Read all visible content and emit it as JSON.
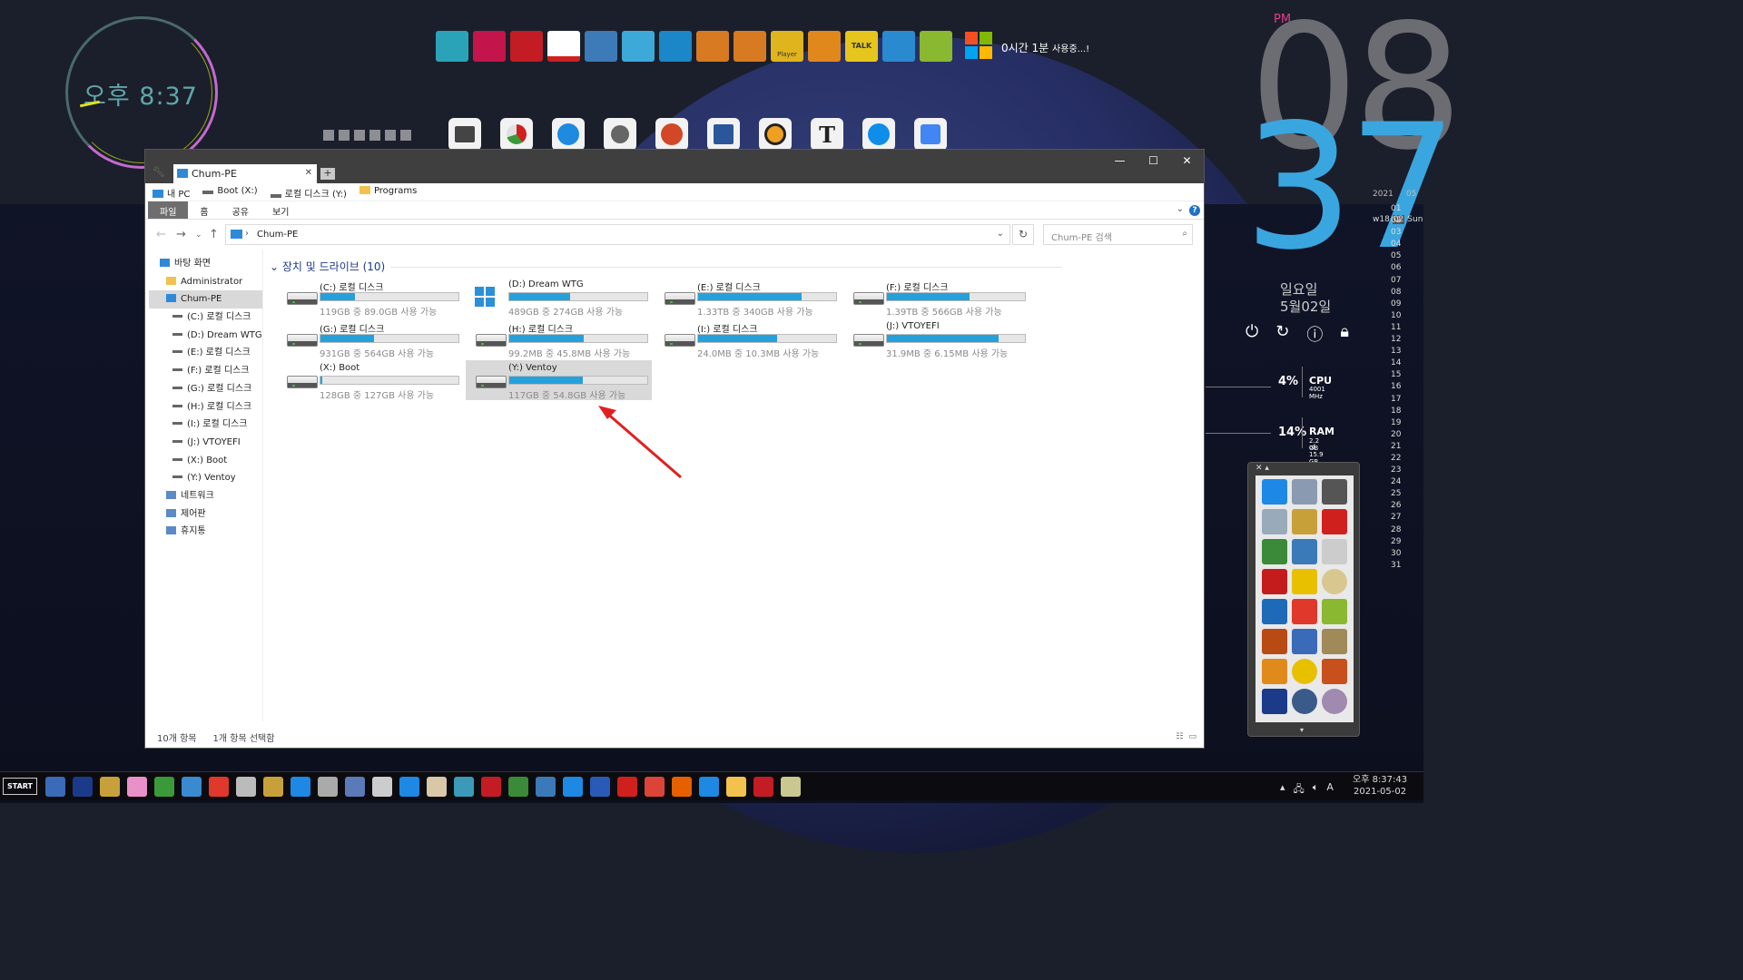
{
  "desktop": {
    "analog_clock_text": "오후 8:37",
    "usage_text": "0시간 1분",
    "usage_suffix": "사용중...!",
    "big_clock": {
      "ampm": "PM",
      "hour": "08",
      "minute": "37",
      "weekday": "일요일",
      "date": "5월02일"
    },
    "calendar": {
      "year": "2021",
      "month": "05",
      "week": "w18",
      "today": "02",
      "today_day": "Sun",
      "days": [
        "01",
        "02",
        "03",
        "04",
        "05",
        "06",
        "07",
        "08",
        "09",
        "10",
        "11",
        "12",
        "13",
        "14",
        "15",
        "16",
        "17",
        "18",
        "19",
        "20",
        "21",
        "22",
        "23",
        "24",
        "25",
        "26",
        "27",
        "28",
        "29",
        "30",
        "31"
      ]
    },
    "cpu": {
      "percent": "4%",
      "label": "CPU",
      "sub": "4001 MHz"
    },
    "ram": {
      "percent": "14%",
      "label": "RAM",
      "sub1": "2.2 GB",
      "sub2": "of 15.9 GB"
    },
    "dock_player_label": "Player",
    "dock_talk_label": "TALK",
    "dock_t_label": "T"
  },
  "window": {
    "tab_title": "Chum-PE",
    "new_tab": "+",
    "minimize": "—",
    "maximize": "☐",
    "close": "✕",
    "bookmarks": [
      "내 PC",
      "Boot (X:)",
      "로컬 디스크 (Y:)",
      "Programs"
    ],
    "ribbon_tabs": [
      "파일",
      "홈",
      "공유",
      "보기"
    ],
    "help": "?",
    "address": "Chum-PE",
    "search_placeholder": "Chum-PE 검색",
    "nav": [
      {
        "label": "바탕 화면",
        "indent": 0
      },
      {
        "label": "Administrator",
        "indent": 1
      },
      {
        "label": "Chum-PE",
        "indent": 1,
        "selected": true
      },
      {
        "label": "(C:) 로컬 디스크",
        "indent": 2
      },
      {
        "label": "(D:) Dream WTG",
        "indent": 2
      },
      {
        "label": "(E:) 로컬 디스크",
        "indent": 2
      },
      {
        "label": "(F:) 로컬 디스크",
        "indent": 2
      },
      {
        "label": "(G:) 로컬 디스크",
        "indent": 2
      },
      {
        "label": "(H:) 로컬 디스크",
        "indent": 2
      },
      {
        "label": "(I:) 로컬 디스크",
        "indent": 2
      },
      {
        "label": "(J:) VTOYEFI",
        "indent": 2
      },
      {
        "label": "(X:) Boot",
        "indent": 2
      },
      {
        "label": "(Y:) Ventoy",
        "indent": 2
      },
      {
        "label": "네트워크",
        "indent": 1
      },
      {
        "label": "제어판",
        "indent": 1
      },
      {
        "label": "휴지통",
        "indent": 1
      }
    ],
    "group_header": "장치 및 드라이브 (10)",
    "drives": [
      {
        "name": "(C:) 로컬 디스크",
        "info": "119GB 중 89.0GB 사용 가능",
        "used": 0.25
      },
      {
        "name": "(D:) Dream WTG",
        "info": "489GB 중 274GB 사용 가능",
        "used": 0.44,
        "windows": true
      },
      {
        "name": "(E:) 로컬 디스크",
        "info": "1.33TB 중 340GB 사용 가능",
        "used": 0.75
      },
      {
        "name": "(F:) 로컬 디스크",
        "info": "1.39TB 중 566GB 사용 가능",
        "used": 0.6
      },
      {
        "name": "(G:) 로컬 디스크",
        "info": "931GB 중 564GB 사용 가능",
        "used": 0.39
      },
      {
        "name": "(H:) 로컬 디스크",
        "info": "99.2MB 중 45.8MB 사용 가능",
        "used": 0.54
      },
      {
        "name": "(I:) 로컬 디스크",
        "info": "24.0MB 중 10.3MB 사용 가능",
        "used": 0.57
      },
      {
        "name": "(J:) VTOYEFI",
        "info": "31.9MB 중 6.15MB 사용 가능",
        "used": 0.81
      },
      {
        "name": "(X:) Boot",
        "info": "128GB 중 127GB 사용 가능",
        "used": 0.01
      },
      {
        "name": "(Y:) Ventoy",
        "info": "117GB 중 54.8GB 사용 가능",
        "used": 0.53,
        "selected": true
      }
    ],
    "status_count": "10개 항목",
    "status_selected": "1개 항목 선택함"
  },
  "taskbar": {
    "start_label": "START",
    "ime": "A",
    "time": "오후 8:37:43",
    "date": "2021-05-02"
  },
  "colors": {
    "accent": "#26a0da",
    "clock_blue": "#3aa6df",
    "arrow": "#e02020"
  }
}
